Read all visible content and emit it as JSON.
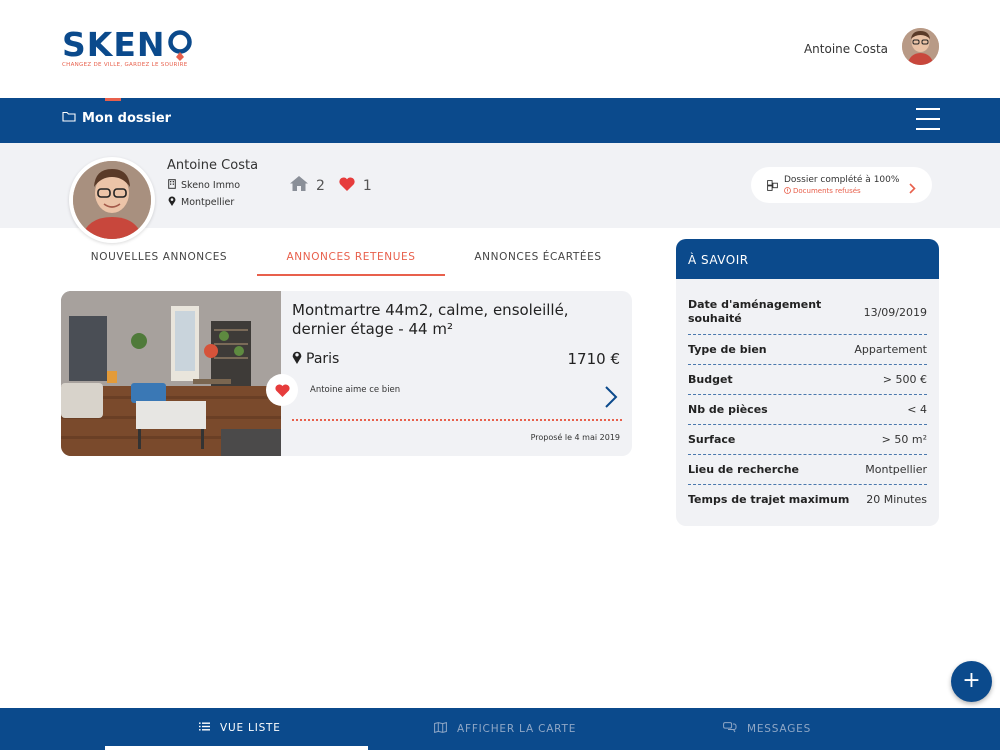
{
  "header": {
    "logo_text": "SKEN",
    "logo_tagline": "CHANGEZ DE VILLE, GARDEZ LE SOURIRE",
    "user_name": "Antoine Costa"
  },
  "nav": {
    "title": "Mon dossier"
  },
  "profile": {
    "name": "Antoine Costa",
    "agency": "Skeno Immo",
    "city": "Montpellier",
    "houses_count": "2",
    "likes_count": "1",
    "dossier_status": "Dossier complété à 100%",
    "dossier_warning": "Documents refusés"
  },
  "tabs": [
    {
      "label": "NOUVELLES ANNONCES"
    },
    {
      "label": "ANNONCES RETENUES",
      "active": true
    },
    {
      "label": "ANNONCES ÉCARTÉES"
    }
  ],
  "listing": {
    "title": "Montmartre 44m2, calme, ensoleillé, dernier étage - 44 m²",
    "location": "Paris",
    "price": "1710 €",
    "likes_text": "Antoine aime ce bien",
    "proposed": "Proposé le 4 mai 2019"
  },
  "info_panel": {
    "title": "À SAVOIR",
    "rows": [
      {
        "label": "Date d'aménagement souhaité",
        "value": "13/09/2019"
      },
      {
        "label": "Type de bien",
        "value": "Appartement"
      },
      {
        "label": "Budget",
        "value": "> 500 €"
      },
      {
        "label": "Nb de pièces",
        "value": "< 4"
      },
      {
        "label": "Surface",
        "value": "> 50 m²"
      },
      {
        "label": "Lieu de recherche",
        "value": "Montpellier"
      },
      {
        "label": "Temps de trajet maximum",
        "value": "20 Minutes"
      }
    ]
  },
  "fab": {
    "label": "+"
  },
  "bottom_nav": [
    {
      "label": "VUE LISTE",
      "icon": "list-icon",
      "active": true
    },
    {
      "label": "AFFICHER LA CARTE",
      "icon": "map-icon"
    },
    {
      "label": "MESSAGES",
      "icon": "chat-icon"
    }
  ],
  "colors": {
    "brand_blue": "#0b4a8c",
    "accent_orange": "#e8604c",
    "panel_gray": "#f1f2f5"
  }
}
